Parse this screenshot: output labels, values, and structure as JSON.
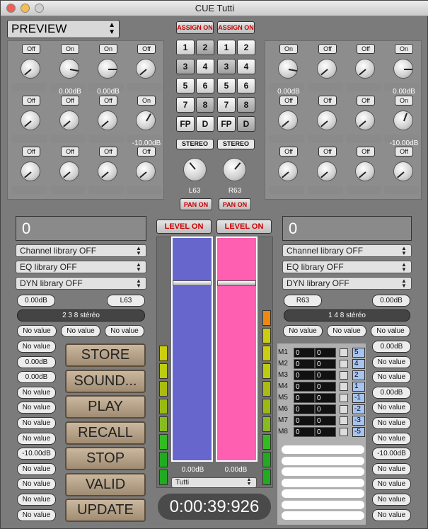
{
  "window": {
    "title": "CUE Tutti"
  },
  "mode_select": {
    "value": "PREVIEW"
  },
  "left_toggles": [
    "Off",
    "On",
    "On",
    "Off",
    "Off",
    "Off",
    "Off",
    "On",
    "Off",
    "Off",
    "Off",
    "Off"
  ],
  "right_toggles": [
    "On",
    "Off",
    "Off",
    "On",
    "Off",
    "Off",
    "Off",
    "On",
    "Off",
    "Off",
    "Off",
    "Off"
  ],
  "left_db": {
    "r1c2": "0.00dB",
    "r1c3": "0.00dB",
    "r2c4": "-10.00dB"
  },
  "right_db": {
    "r1c1": "0.00dB",
    "r1c4": "0.00dB",
    "r2c4": "-10.00dB"
  },
  "center": {
    "assign_left": "ASSIGN ON",
    "assign_right": "ASSIGN ON",
    "num_left": [
      "1",
      "2",
      "3",
      "4",
      "5",
      "6",
      "7",
      "8",
      "FP",
      "D"
    ],
    "num_right": [
      "1",
      "2",
      "3",
      "4",
      "5",
      "6",
      "7",
      "8",
      "FP",
      "D"
    ],
    "stereo_left": "STEREO",
    "stereo_right": "STEREO",
    "pan_label_left": "L63",
    "pan_label_right": "R63",
    "pan_on_left": "PAN ON",
    "pan_on_right": "PAN ON",
    "level_on_left": "LEVEL ON",
    "level_on_right": "LEVEL ON",
    "fader_db_left": "0.00dB",
    "fader_db_right": "0.00dB",
    "group_select": "Tutti",
    "timer": "0:00:39:926",
    "fader_left_color": "#6666cc",
    "fader_right_color": "#ff5fb0"
  },
  "left_panel": {
    "number": "0",
    "channel_lib": "Channel library OFF",
    "eq_lib": "EQ library OFF",
    "dyn_lib": "DYN library OFF",
    "gain": "0.00dB",
    "pan": "L63",
    "assign": "2 3 8 stéréo",
    "row1": [
      "No value",
      "No value",
      "No value"
    ],
    "col": [
      "No value",
      "0.00dB",
      "0.00dB",
      "No value",
      "No value",
      "No value",
      "No value",
      "-10.00dB",
      "No value",
      "No value",
      "No value",
      "No value"
    ]
  },
  "right_panel": {
    "number": "0",
    "channel_lib": "Channel library OFF",
    "eq_lib": "EQ library OFF",
    "dyn_lib": "DYN library OFF",
    "pan": "R63",
    "gain": "0.00dB",
    "assign": "1 4 8 stéréo",
    "row1": [
      "No value",
      "No value",
      "No value"
    ],
    "col": [
      "0.00dB",
      "No value",
      "No value",
      "0.00dB",
      "No value",
      "No value",
      "No value",
      "-10.00dB",
      "No value",
      "No value",
      "No value",
      "No value"
    ]
  },
  "actions": [
    "STORE",
    "SOUND...",
    "PLAY",
    "RECALL",
    "STOP",
    "VALID",
    "UPDATE"
  ],
  "matrix": [
    {
      "label": "M1",
      "a": "0",
      "b": "0",
      "v": "5"
    },
    {
      "label": "M2",
      "a": "0",
      "b": "0",
      "v": "4"
    },
    {
      "label": "M3",
      "a": "0",
      "b": "0",
      "v": "2"
    },
    {
      "label": "M4",
      "a": "0",
      "b": "0",
      "v": "1"
    },
    {
      "label": "M5",
      "a": "0",
      "b": "0",
      "v": "-1"
    },
    {
      "label": "M6",
      "a": "0",
      "b": "0",
      "v": "-2"
    },
    {
      "label": "M7",
      "a": "0",
      "b": "0",
      "v": "-3"
    },
    {
      "label": "M8",
      "a": "0",
      "b": "0",
      "v": "-5"
    }
  ]
}
